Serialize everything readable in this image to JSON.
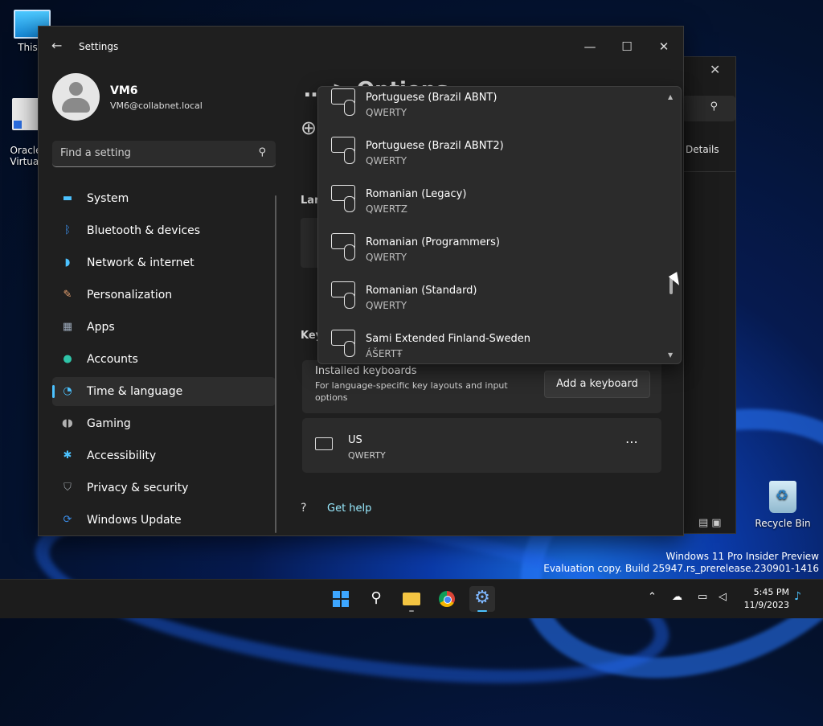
{
  "desktop": {
    "icons": [
      {
        "label": "This P"
      },
      {
        "label": "Oracle\nVirtual"
      },
      {
        "label": "Recycle Bin"
      }
    ],
    "watermark": {
      "line1": "Windows 11 Pro Insider Preview",
      "line2": "Evaluation copy. Build 25947.rs_prerelease.230901-1416"
    }
  },
  "background_window": {
    "details_label": "Details"
  },
  "settings": {
    "title": "Settings",
    "user": {
      "name": "VM6",
      "email": "VM6@collabnet.local"
    },
    "search": {
      "placeholder": "Find a setting"
    },
    "nav": [
      {
        "label": "System",
        "icon": "monitor-icon",
        "color": "#4cc2ff",
        "active": false
      },
      {
        "label": "Bluetooth & devices",
        "icon": "bluetooth-icon",
        "color": "#3b8eea",
        "active": false
      },
      {
        "label": "Network & internet",
        "icon": "wifi-icon",
        "color": "#4cc2ff",
        "active": false
      },
      {
        "label": "Personalization",
        "icon": "brush-icon",
        "color": "#e8a270",
        "active": false
      },
      {
        "label": "Apps",
        "icon": "apps-icon",
        "color": "#9aa7b8",
        "active": false
      },
      {
        "label": "Accounts",
        "icon": "person-icon",
        "color": "#2fc4a8",
        "active": false
      },
      {
        "label": "Time & language",
        "icon": "globe-clock-icon",
        "color": "#4cc2ff",
        "active": true
      },
      {
        "label": "Gaming",
        "icon": "controller-icon",
        "color": "#b0b0b0",
        "active": false
      },
      {
        "label": "Accessibility",
        "icon": "accessibility-icon",
        "color": "#4cc2ff",
        "active": false
      },
      {
        "label": "Privacy & security",
        "icon": "shield-icon",
        "color": "#9aa0a6",
        "active": false
      },
      {
        "label": "Windows Update",
        "icon": "update-icon",
        "color": "#3b8eea",
        "active": false
      }
    ],
    "content": {
      "header": "… > Options",
      "lan_label": "Lan",
      "key_label": "Key",
      "installed": {
        "title": "Installed keyboards",
        "subtitle": "For language-specific key layouts and input options",
        "button": "Add a keyboard"
      },
      "keyboard": {
        "name": "US",
        "layout": "QWERTY",
        "more": "⋯"
      },
      "help": "Get help"
    },
    "dropdown": {
      "items": [
        {
          "name": "Portuguese (Brazil ABNT)",
          "layout": "QWERTY"
        },
        {
          "name": "Portuguese (Brazil ABNT2)",
          "layout": "QWERTY"
        },
        {
          "name": "Romanian (Legacy)",
          "layout": "QWERTZ"
        },
        {
          "name": "Romanian (Programmers)",
          "layout": "QWERTY"
        },
        {
          "name": "Romanian (Standard)",
          "layout": "QWERTY"
        },
        {
          "name": "Sami Extended Finland-Sweden",
          "layout": "ÁŠERTŦ"
        }
      ]
    }
  },
  "taskbar": {
    "clock": {
      "time": "5:45 PM",
      "date": "11/9/2023"
    }
  }
}
